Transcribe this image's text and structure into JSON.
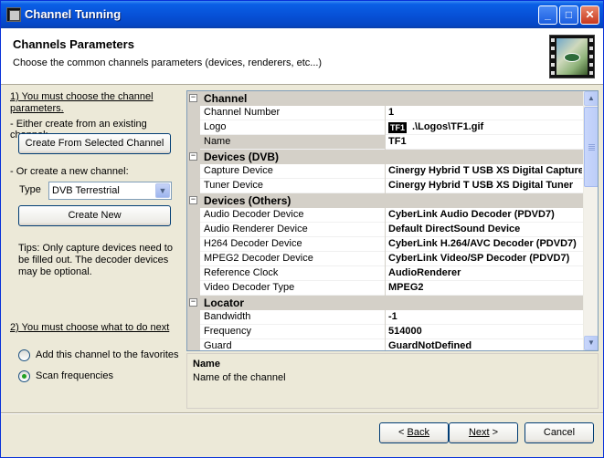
{
  "window": {
    "title": "Channel Tunning"
  },
  "header": {
    "title": "Channels Parameters",
    "subtitle": "Choose the common channels parameters (devices, renderers, etc...)"
  },
  "left": {
    "step1_line1": "1) You must choose the channel",
    "step1_line2": "parameters.",
    "either_label": "- Either create from an existing channel:",
    "create_from_selected_label": "Create From Selected Channel",
    "or_label": "- Or create a new channel:",
    "type_label": "Type",
    "type_value": "DVB Terrestrial",
    "create_new_label": "Create New",
    "tips_line1": "Tips: Only capture devices need to",
    "tips_line2": "be filled out. The decoder devices",
    "tips_line3": "may be optional.",
    "step2_label": "2) You must choose what to do next",
    "option_favorites": "Add this channel to the favorites",
    "option_scan": "Scan frequencies",
    "selected_option": "Scan frequencies"
  },
  "grid": {
    "categories": [
      {
        "label": "Channel",
        "expander": "⊟",
        "rows": [
          {
            "name": "Channel Number",
            "value": "1"
          },
          {
            "name": "Logo",
            "value": ".\\Logos\\TF1.gif"
          },
          {
            "name": "Name",
            "value": "TF1"
          }
        ]
      },
      {
        "label": "Devices (DVB)",
        "expander": "⊟",
        "rows": [
          {
            "name": "Capture Device",
            "value": "Cinergy Hybrid T USB XS Digital Capture"
          },
          {
            "name": "Tuner Device",
            "value": "Cinergy Hybrid T USB XS Digital Tuner"
          }
        ]
      },
      {
        "label": "Devices (Others)",
        "expander": "⊟",
        "rows": [
          {
            "name": "Audio Decoder Device",
            "value": "CyberLink Audio Decoder (PDVD7)"
          },
          {
            "name": "Audio Renderer Device",
            "value": "Default DirectSound Device"
          },
          {
            "name": "H264 Decoder Device",
            "value": "CyberLink H.264/AVC Decoder (PDVD7)"
          },
          {
            "name": "MPEG2 Decoder Device",
            "value": "CyberLink Video/SP Decoder (PDVD7)"
          },
          {
            "name": "Reference Clock",
            "value": "AudioRenderer"
          },
          {
            "name": "Video Decoder Type",
            "value": "MPEG2"
          }
        ]
      },
      {
        "label": "Locator",
        "expander": "⊟",
        "rows": [
          {
            "name": "Bandwidth",
            "value": "-1"
          },
          {
            "name": "Frequency",
            "value": "514000"
          },
          {
            "name": "Guard",
            "value": "GuardNotDefined"
          }
        ]
      }
    ],
    "logo_icon_text": "TF1"
  },
  "description": {
    "title": "Name",
    "text": "Name of the channel"
  },
  "footer": {
    "back_label": "Back",
    "back_prefix": "< ",
    "next_label": "Next",
    "next_suffix": " >",
    "cancel_label": "Cancel"
  },
  "icons": {
    "window_icon": "clapperboard-icon",
    "minimize": "minimize-icon",
    "maximize": "maximize-icon",
    "close": "close-icon",
    "header_logo": "film-eye-logo",
    "dropdown": "chevron-down-icon",
    "scroll_up": "scroll-up-icon",
    "scroll_down": "scroll-down-icon"
  },
  "colors": {
    "titlebar": "#0752d8",
    "dialog_bg": "#ece9d8",
    "category_bg": "#d4d0c8",
    "radio_dot": "#21a121"
  }
}
